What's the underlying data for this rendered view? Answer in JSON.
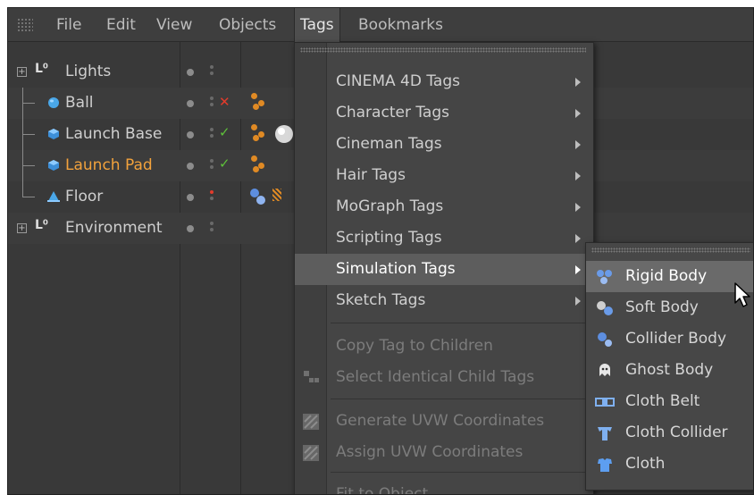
{
  "menubar": {
    "items": [
      "File",
      "Edit",
      "View",
      "Objects",
      "Tags",
      "Bookmarks"
    ],
    "active": "Tags"
  },
  "objects": [
    {
      "name": "Lights",
      "selected": false,
      "expandable": true,
      "icon": "null-icon"
    },
    {
      "name": "Ball",
      "selected": false,
      "expandable": false,
      "icon": "sphere-icon",
      "status": "cross"
    },
    {
      "name": "Launch Base",
      "selected": false,
      "expandable": false,
      "icon": "cube-icon",
      "status": "check"
    },
    {
      "name": "Launch Pad",
      "selected": true,
      "expandable": false,
      "icon": "cube-icon",
      "status": "check"
    },
    {
      "name": "Floor",
      "selected": false,
      "expandable": false,
      "icon": "floor-icon",
      "status": "red-dot"
    },
    {
      "name": "Environment",
      "selected": false,
      "expandable": true,
      "icon": "null-icon"
    }
  ],
  "tags_menu": {
    "items": [
      {
        "label": "CINEMA 4D Tags",
        "submenu": true,
        "enabled": true
      },
      {
        "label": "Character Tags",
        "submenu": true,
        "enabled": true
      },
      {
        "label": "Cineman Tags",
        "submenu": true,
        "enabled": true
      },
      {
        "label": "Hair Tags",
        "submenu": true,
        "enabled": true
      },
      {
        "label": "MoGraph Tags",
        "submenu": true,
        "enabled": true
      },
      {
        "label": "Scripting Tags",
        "submenu": true,
        "enabled": true
      },
      {
        "label": "Simulation Tags",
        "submenu": true,
        "enabled": true,
        "highlighted": true
      },
      {
        "label": "Sketch Tags",
        "submenu": true,
        "enabled": true
      },
      {
        "label": "Copy Tag to Children",
        "submenu": false,
        "enabled": false
      },
      {
        "label": "Select Identical Child Tags",
        "submenu": false,
        "enabled": false
      },
      {
        "label": "Generate UVW Coordinates",
        "submenu": false,
        "enabled": false
      },
      {
        "label": "Assign UVW Coordinates",
        "submenu": false,
        "enabled": false
      },
      {
        "label": "Fit to Object",
        "submenu": false,
        "enabled": false
      }
    ]
  },
  "simulation_submenu": {
    "items": [
      {
        "label": "Rigid Body",
        "icon": "rigid-body-icon",
        "highlighted": true
      },
      {
        "label": "Soft Body",
        "icon": "soft-body-icon"
      },
      {
        "label": "Collider Body",
        "icon": "collider-body-icon"
      },
      {
        "label": "Ghost Body",
        "icon": "ghost-body-icon"
      },
      {
        "label": "Cloth Belt",
        "icon": "cloth-belt-icon"
      },
      {
        "label": "Cloth Collider",
        "icon": "cloth-collider-icon"
      },
      {
        "label": "Cloth",
        "icon": "cloth-icon"
      }
    ]
  },
  "colors": {
    "background": "#373737",
    "selected_text": "#f2a23c",
    "menu_highlight": "#5d5d5d",
    "check": "#5ec03a",
    "cross": "#e23b2b"
  }
}
